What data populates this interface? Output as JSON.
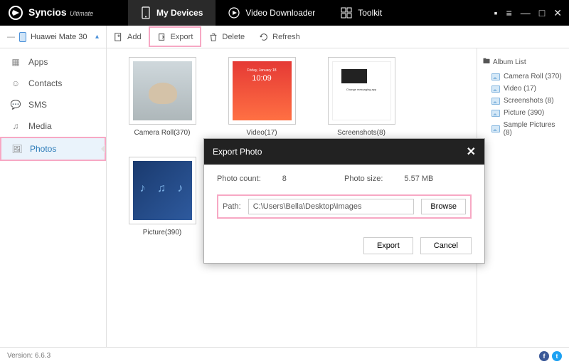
{
  "app": {
    "name": "Syncios",
    "edition": "Ultimate",
    "version_label": "Version: 6.6.3"
  },
  "nav": {
    "my_devices": "My Devices",
    "video_downloader": "Video Downloader",
    "toolkit": "Toolkit"
  },
  "device": {
    "name": "Huawei Mate 30"
  },
  "toolbar": {
    "add": "Add",
    "export": "Export",
    "delete": "Delete",
    "refresh": "Refresh"
  },
  "sidebar": {
    "apps": "Apps",
    "contacts": "Contacts",
    "sms": "SMS",
    "media": "Media",
    "photos": "Photos"
  },
  "albums": [
    {
      "label": "Camera Roll(370)"
    },
    {
      "label": "Video(17)"
    },
    {
      "label": "Screenshots(8)"
    },
    {
      "label": "Picture(390)"
    },
    {
      "label": "Sample Pictures(8)"
    }
  ],
  "album_list": {
    "title": "Album List",
    "items": [
      "Camera Roll (370)",
      "Video (17)",
      "Screenshots (8)",
      "Picture (390)",
      "Sample Pictures (8)"
    ]
  },
  "modal": {
    "title": "Export Photo",
    "count_label": "Photo count:",
    "count_value": "8",
    "size_label": "Photo size:",
    "size_value": "5.57 MB",
    "path_label": "Path:",
    "path_value": "C:\\Users\\Bella\\Desktop\\Images",
    "browse": "Browse",
    "export": "Export",
    "cancel": "Cancel"
  }
}
